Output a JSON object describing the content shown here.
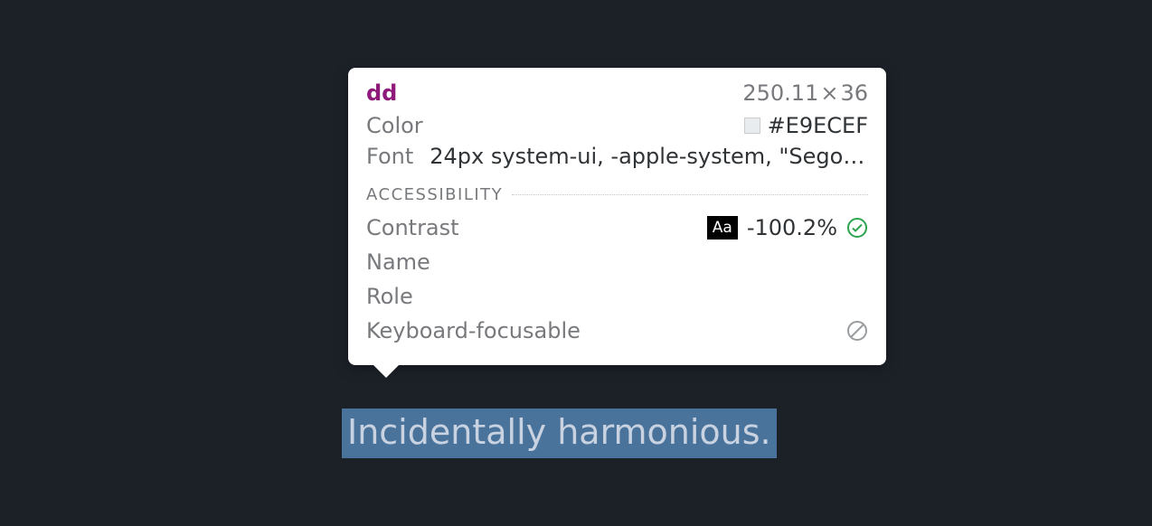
{
  "tooltip": {
    "element_tag": "dd",
    "dimensions": {
      "width": "250.11",
      "height": "36"
    },
    "color": {
      "label": "Color",
      "value": "#E9ECEF"
    },
    "font": {
      "label": "Font",
      "value": "24px system-ui, -apple-system, \"Segoe…"
    },
    "accessibility": {
      "header": "ACCESSIBILITY",
      "contrast": {
        "label": "Contrast",
        "chip": "Aa",
        "value": "-100.2%"
      },
      "name": {
        "label": "Name"
      },
      "role": {
        "label": "Role"
      },
      "keyboard": {
        "label": "Keyboard-focusable"
      }
    }
  },
  "highlighted_text": "Incidentally harmonious."
}
